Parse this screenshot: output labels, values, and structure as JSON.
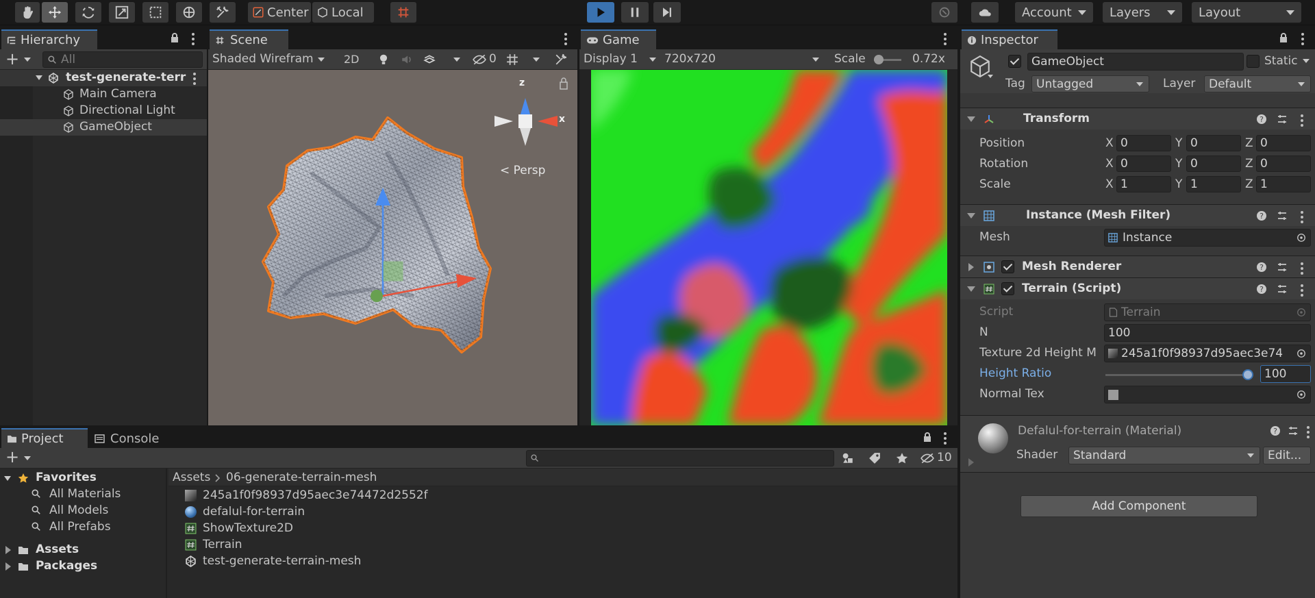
{
  "toolbar": {
    "pivot_label": "Center",
    "space_label": "Local",
    "account_label": "Account",
    "layers_label": "Layers",
    "layout_label": "Layout"
  },
  "hierarchy": {
    "tab_label": "Hierarchy",
    "search_placeholder": "All",
    "scene_name": "test-generate-terr",
    "items": [
      "Main Camera",
      "Directional Light",
      "GameObject"
    ]
  },
  "scene": {
    "tab_label": "Scene",
    "draw_mode": "Shaded Wirefram",
    "mode_2d": "2D",
    "hidden_count": "0",
    "persp_label": "Persp",
    "axis_x": "x",
    "axis_z": "z"
  },
  "game": {
    "tab_label": "Game",
    "display": "Display 1",
    "resolution": "720x720",
    "scale_label": "Scale",
    "scale_value": "0.72x"
  },
  "inspector": {
    "tab_label": "Inspector",
    "object_name": "GameObject",
    "static_label": "Static",
    "tag_label": "Tag",
    "tag_value": "Untagged",
    "layer_label": "Layer",
    "layer_value": "Default",
    "transform": {
      "title": "Transform",
      "rows": [
        {
          "label": "Position",
          "x": "0",
          "y": "0",
          "z": "0"
        },
        {
          "label": "Rotation",
          "x": "0",
          "y": "0",
          "z": "0"
        },
        {
          "label": "Scale",
          "x": "1",
          "y": "1",
          "z": "1"
        }
      ],
      "x_label": "X",
      "y_label": "Y",
      "z_label": "Z"
    },
    "mesh_filter": {
      "title": "Instance (Mesh Filter)",
      "mesh_label": "Mesh",
      "mesh_value": "Instance"
    },
    "mesh_renderer": {
      "title": "Mesh Renderer"
    },
    "terrain_script": {
      "title": "Terrain (Script)",
      "script_label": "Script",
      "script_value": "Terrain",
      "n_label": "N",
      "n_value": "100",
      "texture_label": "Texture 2d Height M",
      "texture_value": "245a1f0f98937d95aec3e74",
      "height_label": "Height Ratio",
      "height_value": "100",
      "height_fraction": 0.97,
      "normal_label": "Normal Tex"
    },
    "material": {
      "name": "Defalul-for-terrain (Material)",
      "shader_label": "Shader",
      "shader_value": "Standard",
      "edit_label": "Edit..."
    },
    "add_component": "Add Component"
  },
  "project": {
    "tab_label": "Project",
    "console_label": "Console",
    "hidden_count": "10",
    "favorites_label": "Favorites",
    "favorites": [
      "All Materials",
      "All Models",
      "All Prefabs"
    ],
    "roots": [
      "Assets",
      "Packages"
    ],
    "breadcrumb_root": "Assets",
    "breadcrumb_folder": "06-generate-terrain-mesh",
    "files": [
      {
        "name": "245a1f0f98937d95aec3e74472d2552f",
        "icon": "texture-icon"
      },
      {
        "name": "defalul-for-terrain",
        "icon": "material-icon"
      },
      {
        "name": "ShowTexture2D",
        "icon": "script-icon"
      },
      {
        "name": "Terrain",
        "icon": "script-icon"
      },
      {
        "name": "test-generate-terrain-mesh",
        "icon": "scene-icon"
      }
    ]
  },
  "colors": {
    "accent": "#3a72b0",
    "selection_outline": "#f07a21",
    "scene_bg": "#6f6762",
    "game_green": "#21e021",
    "game_blue": "#3a4cf0",
    "game_red": "#f04a20"
  }
}
